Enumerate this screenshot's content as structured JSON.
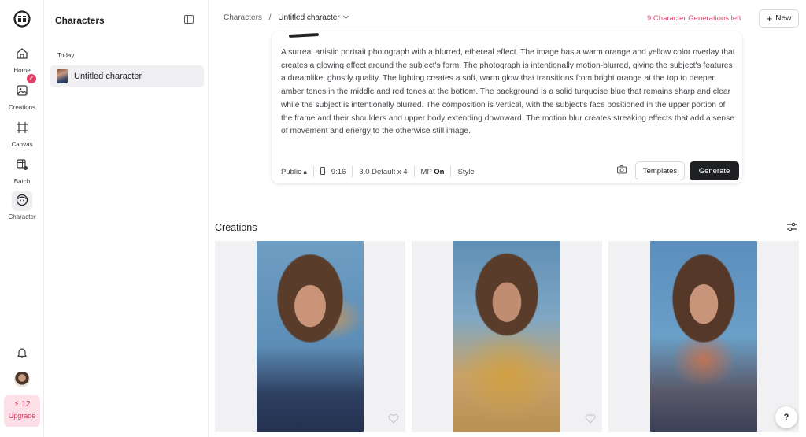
{
  "nav": {
    "items": [
      {
        "label": "Home",
        "icon": "home-icon"
      },
      {
        "label": "Creations",
        "icon": "image-icon",
        "badge": "✓"
      },
      {
        "label": "Canvas",
        "icon": "canvas-icon"
      },
      {
        "label": "Batch",
        "icon": "batch-icon"
      },
      {
        "label": "Character",
        "icon": "character-icon"
      }
    ],
    "upgrade_count": "12",
    "upgrade_label": "Upgrade"
  },
  "panel": {
    "title": "Characters",
    "section": "Today",
    "items": [
      {
        "label": "Untitled character"
      }
    ]
  },
  "header": {
    "breadcrumb_root": "Characters",
    "breadcrumb_sep": "/",
    "breadcrumb_current": "Untitled character",
    "generations_left": "9 Character Generations left",
    "new_label": "New"
  },
  "prompt": {
    "text": "A surreal artistic portrait photograph with a blurred, ethereal effect. The image has a warm orange and yellow color overlay that creates a glowing effect around the subject's form. The photograph is intentionally motion-blurred, giving the subject's features a dreamlike, ghostly quality. The lighting creates a soft, warm glow that transitions from bright orange at the top to deeper amber tones in the middle and red tones at the bottom. The background is a solid turquoise blue that remains sharp and clear while the subject is intentionally blurred. The composition is vertical, with the subject's face positioned in the upper portion of the frame and their shoulders and upper body extending downward. The motion blur creates streaking effects that add a sense of movement and energy to the otherwise still image.",
    "visibility": "Public",
    "aspect": "9:16",
    "model": "3.0 Default x 4",
    "mp_label": "MP",
    "mp_value": "On",
    "style_label": "Style",
    "templates_label": "Templates",
    "generate_label": "Generate"
  },
  "creations": {
    "title": "Creations",
    "help_label": "?"
  },
  "colors": {
    "accent": "#e0456b",
    "dark_button": "#1f2023",
    "photo_bg": "#5f8fb6"
  }
}
